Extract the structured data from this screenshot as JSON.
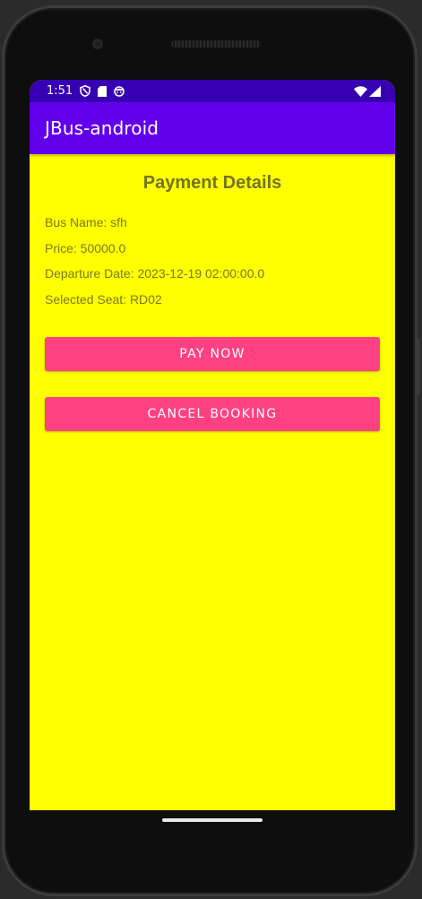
{
  "status_bar": {
    "time": "1:51",
    "icons": [
      "shield-icon",
      "sd-card-icon",
      "face-icon"
    ],
    "right_icons": [
      "wifi-icon",
      "cellular-signal-icon"
    ]
  },
  "app_bar": {
    "title": "JBus-android",
    "color": "#6200ee",
    "status_color": "#3700b3"
  },
  "page": {
    "title": "Payment Details",
    "background": "#ffff00",
    "details": [
      {
        "text": "Bus Name: sfh"
      },
      {
        "text": "Price: 50000.0"
      },
      {
        "text": "Departure Date: 2023-12-19 02:00:00.0"
      },
      {
        "text": "Selected Seat: RD02"
      }
    ]
  },
  "actions": {
    "pay_label": "PAY NOW",
    "cancel_label": "CANCEL BOOKING",
    "button_color": "#ff4081"
  }
}
